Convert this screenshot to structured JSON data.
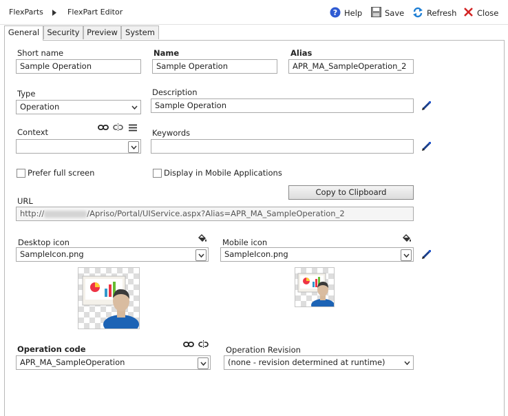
{
  "breadcrumb": {
    "root": "FlexParts",
    "current": "FlexPart Editor"
  },
  "toolbar": {
    "help": "Help",
    "save": "Save",
    "refresh": "Refresh",
    "close": "Close"
  },
  "tabs": [
    "General",
    "Security",
    "Preview",
    "System"
  ],
  "form": {
    "short_name_label": "Short name",
    "short_name_value": "Sample Operation",
    "name_label": "Name",
    "name_value": "Sample Operation",
    "alias_label": "Alias",
    "alias_value": "APR_MA_SampleOperation_2",
    "type_label": "Type",
    "type_value": "Operation",
    "description_label": "Description",
    "description_value": "Sample Operation",
    "context_label": "Context",
    "context_value": "",
    "keywords_label": "Keywords",
    "keywords_value": "",
    "prefer_full_screen_label": "Prefer full screen",
    "display_mobile_label": "Display in Mobile Applications",
    "copy_button": "Copy to Clipboard",
    "url_label": "URL",
    "url_prefix": "http://",
    "url_suffix": "/Apriso/Portal/UIService.aspx?Alias=APR_MA_SampleOperation_2",
    "desktop_icon_label": "Desktop icon",
    "desktop_icon_value": "SampleIcon.png",
    "mobile_icon_label": "Mobile icon",
    "mobile_icon_value": "SampleIcon.png",
    "operation_code_label": "Operation code",
    "operation_code_value": "APR_MA_SampleOperation",
    "operation_revision_label": "Operation Revision",
    "operation_revision_value": "(none - revision determined at runtime)"
  },
  "colors": {
    "help_icon": "#2f5bd3",
    "refresh_icon": "#1f7fd4",
    "close_icon": "#d22222",
    "accent": "#2255cc"
  }
}
